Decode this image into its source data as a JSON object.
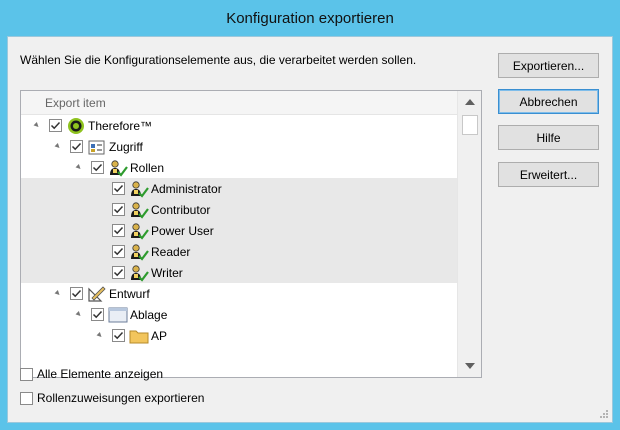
{
  "window": {
    "title": "Konfiguration exportieren"
  },
  "instruction": "Wählen Sie die Konfigurationselemente aus, die verarbeitet werden sollen.",
  "buttons": {
    "export": "Exportieren...",
    "cancel": "Abbrechen",
    "help": "Hilfe",
    "advanced": "Erweitert..."
  },
  "tree": {
    "header": "Export item",
    "items": [
      {
        "label": "Therefore™",
        "level": 0,
        "expand": "▲",
        "icon": "therefore-logo-icon",
        "checked": true,
        "selected": false
      },
      {
        "label": "Zugriff",
        "level": 1,
        "expand": "▲",
        "icon": "access-icon",
        "checked": true,
        "selected": false
      },
      {
        "label": "Rollen",
        "level": 2,
        "expand": "▲",
        "icon": "role-icon",
        "checked": true,
        "selected": false
      },
      {
        "label": "Administrator",
        "level": 3,
        "expand": "",
        "icon": "role-icon",
        "checked": true,
        "selected": true
      },
      {
        "label": "Contributor",
        "level": 3,
        "expand": "",
        "icon": "role-icon",
        "checked": true,
        "selected": true
      },
      {
        "label": "Power User",
        "level": 3,
        "expand": "",
        "icon": "role-icon",
        "checked": true,
        "selected": true
      },
      {
        "label": "Reader",
        "level": 3,
        "expand": "",
        "icon": "role-icon",
        "checked": true,
        "selected": true
      },
      {
        "label": "Writer",
        "level": 3,
        "expand": "",
        "icon": "role-icon",
        "checked": true,
        "selected": true
      },
      {
        "label": "Entwurf",
        "level": 1,
        "expand": "▲",
        "icon": "design-icon",
        "checked": true,
        "selected": false
      },
      {
        "label": "Ablage",
        "level": 2,
        "expand": "▲",
        "icon": "storage-icon",
        "checked": true,
        "selected": false
      },
      {
        "label": "AP",
        "level": 3,
        "expand": "▲",
        "icon": "folder-icon",
        "checked": true,
        "selected": false
      }
    ]
  },
  "options": {
    "show_all": "Alle Elemente anzeigen",
    "export_roles": "Rollenzuweisungen exportieren"
  },
  "colors": {
    "titlebar": "#5bc3e9",
    "check_green": "#2e9b2e",
    "logo_green": "#8fc31f"
  }
}
